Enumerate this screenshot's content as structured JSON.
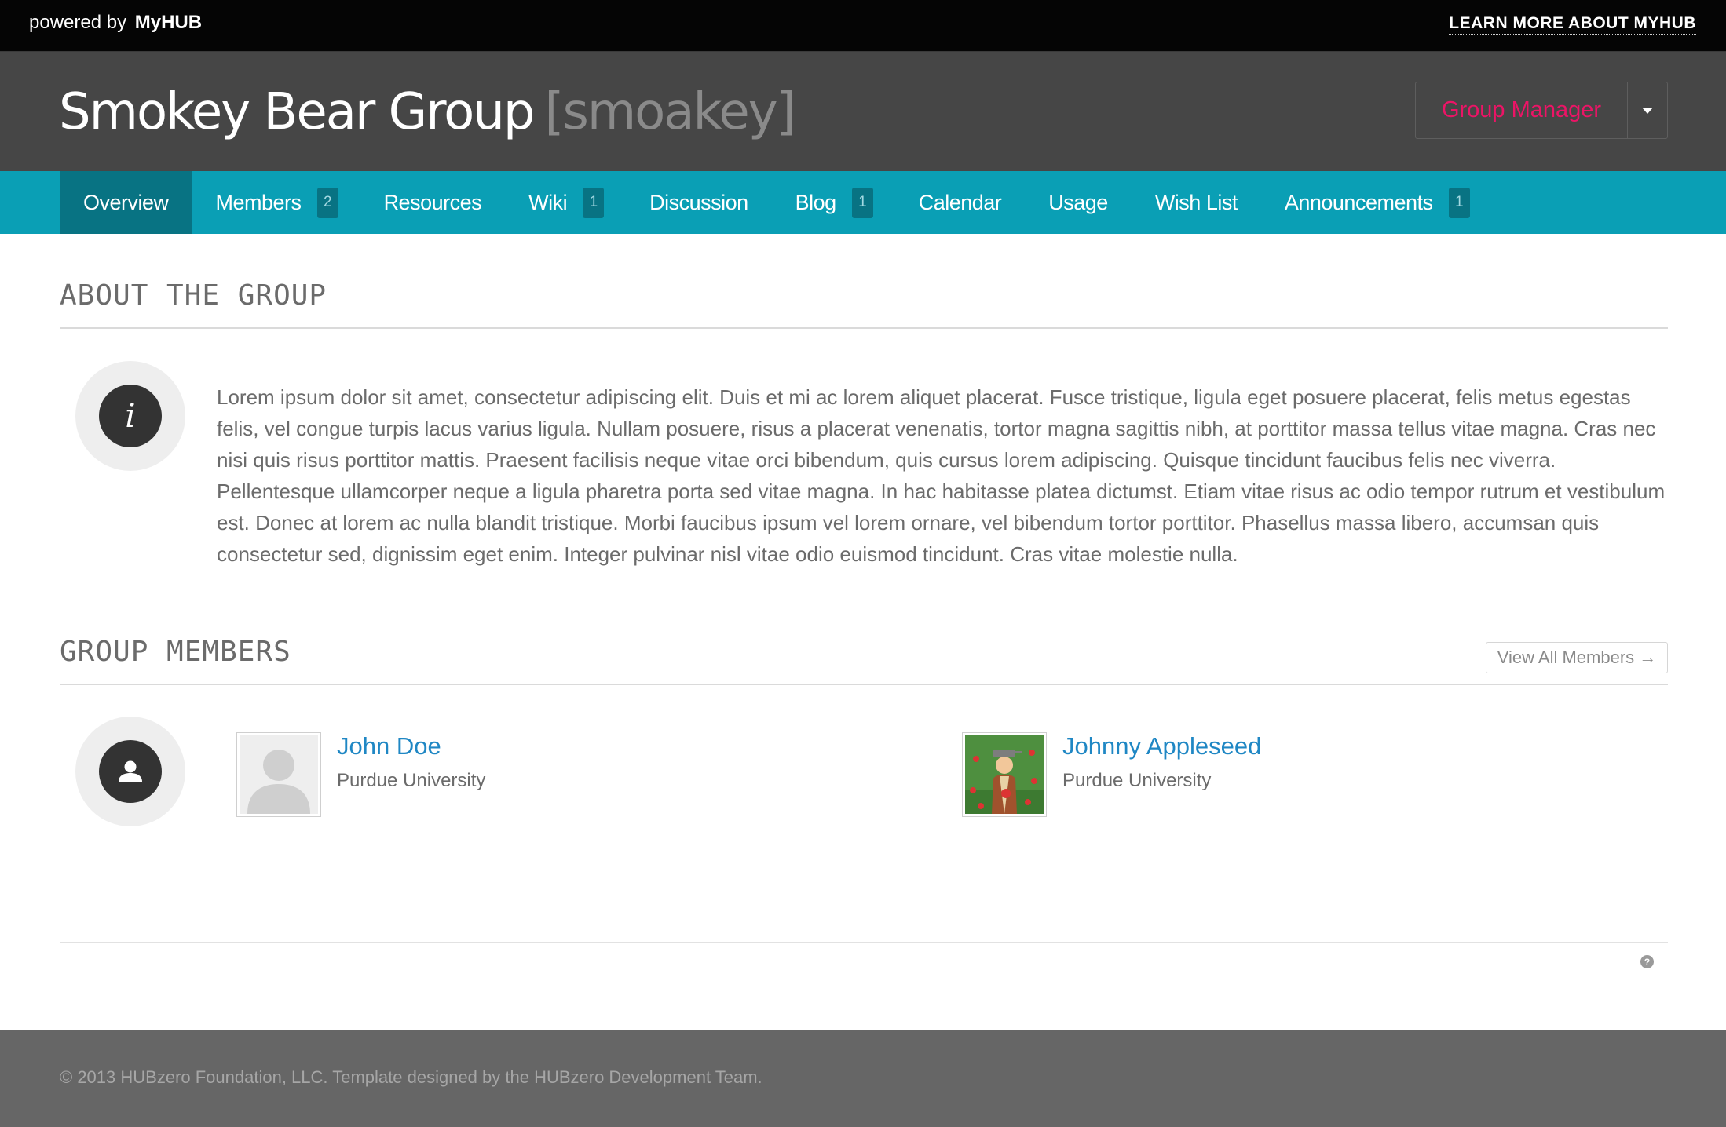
{
  "topbar": {
    "powered_prefix": "powered by",
    "powered_brand": "MyHUB",
    "learn_more": "LEARN MORE ABOUT MYHUB"
  },
  "header": {
    "title": "Smokey Bear Group",
    "cn": "[smoakey]",
    "group_manager": "Group Manager"
  },
  "nav": {
    "items": [
      {
        "label": "Overview",
        "badge": null,
        "active": true
      },
      {
        "label": "Members",
        "badge": "2"
      },
      {
        "label": "Resources",
        "badge": null
      },
      {
        "label": "Wiki",
        "badge": "1"
      },
      {
        "label": "Discussion",
        "badge": null
      },
      {
        "label": "Blog",
        "badge": "1"
      },
      {
        "label": "Calendar",
        "badge": null
      },
      {
        "label": "Usage",
        "badge": null
      },
      {
        "label": "Wish List",
        "badge": null
      },
      {
        "label": "Announcements",
        "badge": "1"
      }
    ]
  },
  "about": {
    "heading": "ABOUT THE GROUP",
    "icon": "info-icon",
    "text": "Lorem ipsum dolor sit amet, consectetur adipiscing elit. Duis et mi ac lorem aliquet placerat. Fusce tristique, ligula eget posuere placerat, felis metus egestas felis, vel congue turpis lacus varius ligula. Nullam posuere, risus a placerat venenatis, tortor magna sagittis nibh, at porttitor massa tellus vitae magna. Cras nec nisi quis risus porttitor mattis. Praesent facilisis neque vitae orci bibendum, quis cursus lorem adipiscing. Quisque tincidunt faucibus felis nec viverra. Pellentesque ullamcorper neque a ligula pharetra porta sed vitae magna. In hac habitasse platea dictumst. Etiam vitae risus ac odio tempor rutrum et vestibulum est. Donec at lorem ac nulla blandit tristique. Morbi faucibus ipsum vel lorem ornare, vel bibendum tortor porttitor. Phasellus massa libero, accumsan quis consectetur sed, dignissim eget enim. Integer pulvinar nisl vitae odio euismod tincidunt. Cras vitae molestie nulla."
  },
  "members": {
    "heading": "GROUP MEMBERS",
    "icon": "user-icon",
    "view_all": "View All Members →",
    "list": [
      {
        "name": "John Doe",
        "org": "Purdue University",
        "avatar": "default-avatar"
      },
      {
        "name": "Johnny Appleseed",
        "org": "Purdue University",
        "avatar": "appleseed-avatar"
      }
    ]
  },
  "footer": {
    "text": "© 2013 HUBzero Foundation, LLC. Template designed by the HUBzero Development Team."
  },
  "colors": {
    "topbar": "#050505",
    "header": "#464646",
    "nav": "#0a9fb5",
    "nav_active": "#087383",
    "accent_pink": "#ec1466",
    "link_blue": "#1f87c4",
    "footer": "#666666"
  }
}
